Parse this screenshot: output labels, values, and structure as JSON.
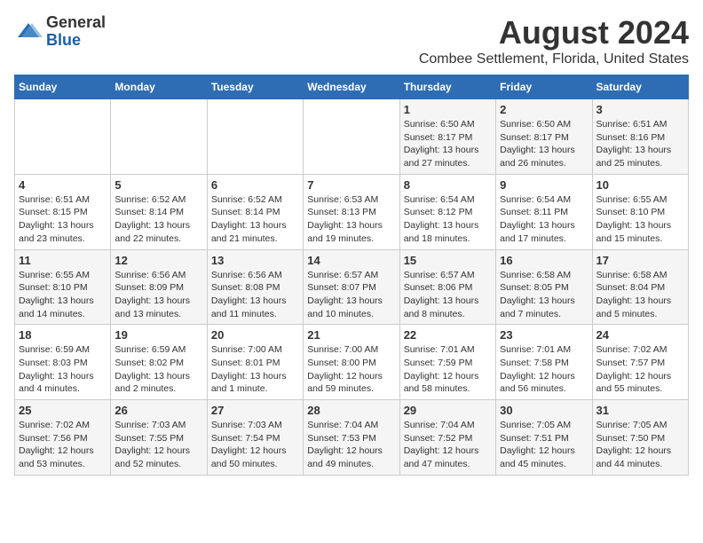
{
  "logo": {
    "general": "General",
    "blue": "Blue"
  },
  "title": "August 2024",
  "subtitle": "Combee Settlement, Florida, United States",
  "days_of_week": [
    "Sunday",
    "Monday",
    "Tuesday",
    "Wednesday",
    "Thursday",
    "Friday",
    "Saturday"
  ],
  "weeks": [
    [
      {
        "day": "",
        "info": ""
      },
      {
        "day": "",
        "info": ""
      },
      {
        "day": "",
        "info": ""
      },
      {
        "day": "",
        "info": ""
      },
      {
        "day": "1",
        "info": "Sunrise: 6:50 AM\nSunset: 8:17 PM\nDaylight: 13 hours\nand 27 minutes."
      },
      {
        "day": "2",
        "info": "Sunrise: 6:50 AM\nSunset: 8:17 PM\nDaylight: 13 hours\nand 26 minutes."
      },
      {
        "day": "3",
        "info": "Sunrise: 6:51 AM\nSunset: 8:16 PM\nDaylight: 13 hours\nand 25 minutes."
      }
    ],
    [
      {
        "day": "4",
        "info": "Sunrise: 6:51 AM\nSunset: 8:15 PM\nDaylight: 13 hours\nand 23 minutes."
      },
      {
        "day": "5",
        "info": "Sunrise: 6:52 AM\nSunset: 8:14 PM\nDaylight: 13 hours\nand 22 minutes."
      },
      {
        "day": "6",
        "info": "Sunrise: 6:52 AM\nSunset: 8:14 PM\nDaylight: 13 hours\nand 21 minutes."
      },
      {
        "day": "7",
        "info": "Sunrise: 6:53 AM\nSunset: 8:13 PM\nDaylight: 13 hours\nand 19 minutes."
      },
      {
        "day": "8",
        "info": "Sunrise: 6:54 AM\nSunset: 8:12 PM\nDaylight: 13 hours\nand 18 minutes."
      },
      {
        "day": "9",
        "info": "Sunrise: 6:54 AM\nSunset: 8:11 PM\nDaylight: 13 hours\nand 17 minutes."
      },
      {
        "day": "10",
        "info": "Sunrise: 6:55 AM\nSunset: 8:10 PM\nDaylight: 13 hours\nand 15 minutes."
      }
    ],
    [
      {
        "day": "11",
        "info": "Sunrise: 6:55 AM\nSunset: 8:10 PM\nDaylight: 13 hours\nand 14 minutes."
      },
      {
        "day": "12",
        "info": "Sunrise: 6:56 AM\nSunset: 8:09 PM\nDaylight: 13 hours\nand 13 minutes."
      },
      {
        "day": "13",
        "info": "Sunrise: 6:56 AM\nSunset: 8:08 PM\nDaylight: 13 hours\nand 11 minutes."
      },
      {
        "day": "14",
        "info": "Sunrise: 6:57 AM\nSunset: 8:07 PM\nDaylight: 13 hours\nand 10 minutes."
      },
      {
        "day": "15",
        "info": "Sunrise: 6:57 AM\nSunset: 8:06 PM\nDaylight: 13 hours\nand 8 minutes."
      },
      {
        "day": "16",
        "info": "Sunrise: 6:58 AM\nSunset: 8:05 PM\nDaylight: 13 hours\nand 7 minutes."
      },
      {
        "day": "17",
        "info": "Sunrise: 6:58 AM\nSunset: 8:04 PM\nDaylight: 13 hours\nand 5 minutes."
      }
    ],
    [
      {
        "day": "18",
        "info": "Sunrise: 6:59 AM\nSunset: 8:03 PM\nDaylight: 13 hours\nand 4 minutes."
      },
      {
        "day": "19",
        "info": "Sunrise: 6:59 AM\nSunset: 8:02 PM\nDaylight: 13 hours\nand 2 minutes."
      },
      {
        "day": "20",
        "info": "Sunrise: 7:00 AM\nSunset: 8:01 PM\nDaylight: 13 hours\nand 1 minute."
      },
      {
        "day": "21",
        "info": "Sunrise: 7:00 AM\nSunset: 8:00 PM\nDaylight: 12 hours\nand 59 minutes."
      },
      {
        "day": "22",
        "info": "Sunrise: 7:01 AM\nSunset: 7:59 PM\nDaylight: 12 hours\nand 58 minutes."
      },
      {
        "day": "23",
        "info": "Sunrise: 7:01 AM\nSunset: 7:58 PM\nDaylight: 12 hours\nand 56 minutes."
      },
      {
        "day": "24",
        "info": "Sunrise: 7:02 AM\nSunset: 7:57 PM\nDaylight: 12 hours\nand 55 minutes."
      }
    ],
    [
      {
        "day": "25",
        "info": "Sunrise: 7:02 AM\nSunset: 7:56 PM\nDaylight: 12 hours\nand 53 minutes."
      },
      {
        "day": "26",
        "info": "Sunrise: 7:03 AM\nSunset: 7:55 PM\nDaylight: 12 hours\nand 52 minutes."
      },
      {
        "day": "27",
        "info": "Sunrise: 7:03 AM\nSunset: 7:54 PM\nDaylight: 12 hours\nand 50 minutes."
      },
      {
        "day": "28",
        "info": "Sunrise: 7:04 AM\nSunset: 7:53 PM\nDaylight: 12 hours\nand 49 minutes."
      },
      {
        "day": "29",
        "info": "Sunrise: 7:04 AM\nSunset: 7:52 PM\nDaylight: 12 hours\nand 47 minutes."
      },
      {
        "day": "30",
        "info": "Sunrise: 7:05 AM\nSunset: 7:51 PM\nDaylight: 12 hours\nand 45 minutes."
      },
      {
        "day": "31",
        "info": "Sunrise: 7:05 AM\nSunset: 7:50 PM\nDaylight: 12 hours\nand 44 minutes."
      }
    ]
  ]
}
